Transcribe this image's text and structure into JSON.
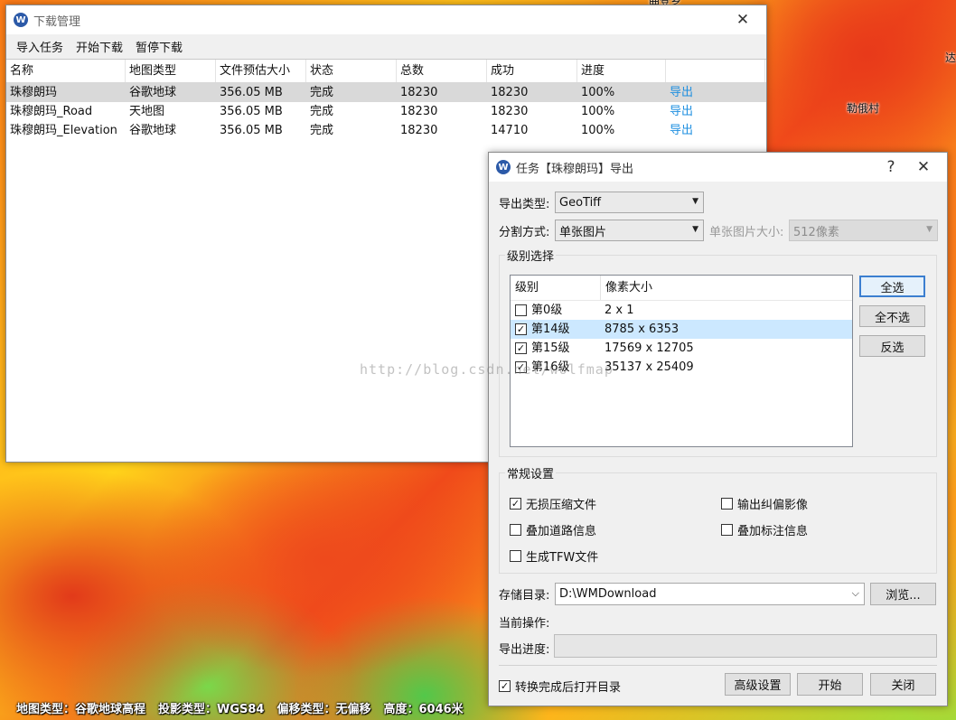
{
  "map": {
    "labels": [
      {
        "text": "曲登乡"
      },
      {
        "text": "勒俄村"
      },
      {
        "text": "达"
      }
    ]
  },
  "statusbar": {
    "map_type": "地图类型：谷歌地球高程",
    "projection": "投影类型：WGS84",
    "offset": "偏移类型：无偏移",
    "height": "高度：6046米"
  },
  "main_window": {
    "title": "下载管理",
    "menu": [
      "导入任务",
      "开始下载",
      "暂停下载"
    ],
    "columns": [
      "名称",
      "地图类型",
      "文件预估大小",
      "状态",
      "总数",
      "成功",
      "进度",
      ""
    ],
    "rows": [
      {
        "name": "珠穆朗玛",
        "map_type": "谷歌地球",
        "size": "356.05 MB",
        "status": "完成",
        "total": "18230",
        "success": "18230",
        "progress": "100%",
        "action": "导出"
      },
      {
        "name": "珠穆朗玛_Road",
        "map_type": "天地图",
        "size": "356.05 MB",
        "status": "完成",
        "total": "18230",
        "success": "18230",
        "progress": "100%",
        "action": "导出"
      },
      {
        "name": "珠穆朗玛_Elevation",
        "map_type": "谷歌地球",
        "size": "356.05 MB",
        "status": "完成",
        "total": "18230",
        "success": "14710",
        "progress": "100%",
        "action": "导出"
      }
    ],
    "selected_row": 0
  },
  "dialog": {
    "title": "任务【珠穆朗玛】导出",
    "help_glyph": "?",
    "close_glyph": "✕",
    "export_type_label": "导出类型:",
    "export_type_value": "GeoTiff",
    "split_label": "分割方式:",
    "split_value": "单张图片",
    "tile_size_label": "单张图片大小:",
    "tile_size_value": "512像素",
    "level_group_title": "级别选择",
    "level_columns": [
      "级别",
      "像素大小"
    ],
    "levels": [
      {
        "name": "第0级",
        "size": "2 x 1",
        "checked": false
      },
      {
        "name": "第14级",
        "size": "8785 x 6353",
        "checked": true
      },
      {
        "name": "第15级",
        "size": "17569 x 12705",
        "checked": true
      },
      {
        "name": "第16级",
        "size": "35137 x 25409",
        "checked": true
      }
    ],
    "highlighted_level": 1,
    "select_all": "全选",
    "select_none": "全不选",
    "invert": "反选",
    "general_group_title": "常规设置",
    "options": [
      {
        "label": "无损压缩文件",
        "checked": true
      },
      {
        "label": "输出纠偏影像",
        "checked": false
      },
      {
        "label": "叠加道路信息",
        "checked": false
      },
      {
        "label": "叠加标注信息",
        "checked": false
      },
      {
        "label": "生成TFW文件",
        "checked": false
      }
    ],
    "save_dir_label": "存储目录:",
    "save_dir_value": "D:\\WMDownload",
    "browse": "浏览...",
    "current_op_label": "当前操作:",
    "progress_label": "导出进度:",
    "progress": 0,
    "open_dir_label": "转换完成后打开目录",
    "open_dir_checked": true,
    "advanced": "高级设置",
    "start": "开始",
    "close": "关闭"
  },
  "watermark": "http://blog.csdn.net/wolfmap"
}
